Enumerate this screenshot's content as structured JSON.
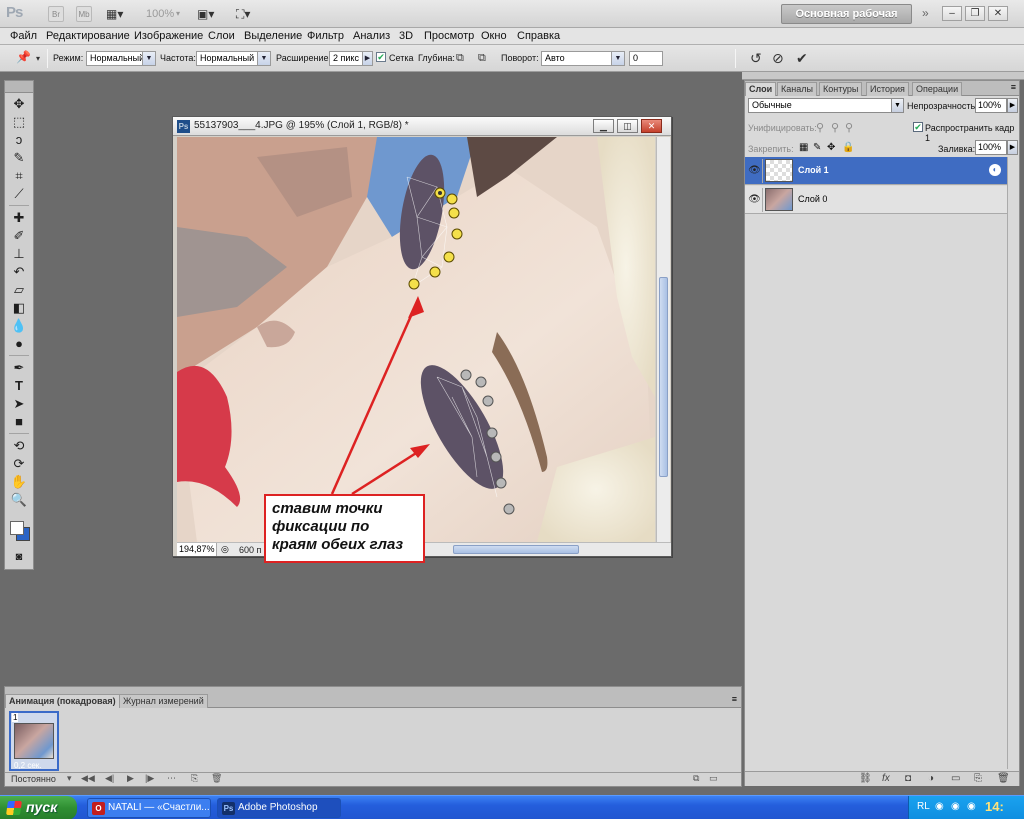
{
  "appbar": {
    "logo": "Ps",
    "zoom": "100%",
    "workspace": "Основная рабочая среда",
    "more": "»"
  },
  "menu": [
    "Файл",
    "Редактирование",
    "Изображение",
    "Слои",
    "Выделение",
    "Фильтр",
    "Анализ",
    "3D",
    "Просмотр",
    "Окно",
    "Справка"
  ],
  "options": {
    "mode_label": "Режим:",
    "mode_value": "Нормальный",
    "freq_label": "Частота:",
    "freq_value": "Нормальный",
    "expand_label": "Расширение:",
    "expand_value": "2 пикс",
    "grid_label": "Сетка",
    "depth_label": "Глубина:",
    "rotation_label": "Поворот:",
    "rotation_value": "Авто",
    "angle_value": "0"
  },
  "document": {
    "title": "55137903___4.JPG @ 195% (Слой 1, RGB/8) *",
    "zoom": "194,87%",
    "info": "600 п"
  },
  "callout": {
    "text": "ставим точки фиксации по краям обеих глаз"
  },
  "layers_panel": {
    "tabs": [
      "Слои",
      "Каналы",
      "Контуры",
      "История",
      "Операции"
    ],
    "blend_mode": "Обычные",
    "opacity_label": "Непрозрачность:",
    "opacity_value": "100%",
    "unify_label": "Унифицировать:",
    "propagate_label": "Распространить кадр 1",
    "lock_label": "Закрепить:",
    "fill_label": "Заливка:",
    "fill_value": "100%",
    "layers": [
      {
        "name": "Слой 1",
        "active": true
      },
      {
        "name": "Слой 0",
        "active": false
      }
    ]
  },
  "animation_panel": {
    "tabs": [
      "Анимация (покадровая)",
      "Журнал измерений"
    ],
    "frame_number": "1",
    "frame_delay": "0,2 сек.",
    "loop": "Постоянно"
  },
  "taskbar": {
    "start": "пуск",
    "items": [
      {
        "label": "NATALI — «Счастли...",
        "icon": "opera-icon"
      },
      {
        "label": "Adobe Photoshop CS...",
        "icon": "photoshop-icon"
      }
    ],
    "lang": "RL",
    "clock": "14:"
  },
  "colors": {
    "selection_blue": "#3f6cc2",
    "annotation_red": "#dd2222",
    "marker_yellow": "#f4e04a",
    "marker_gray": "#b8b8b8"
  }
}
